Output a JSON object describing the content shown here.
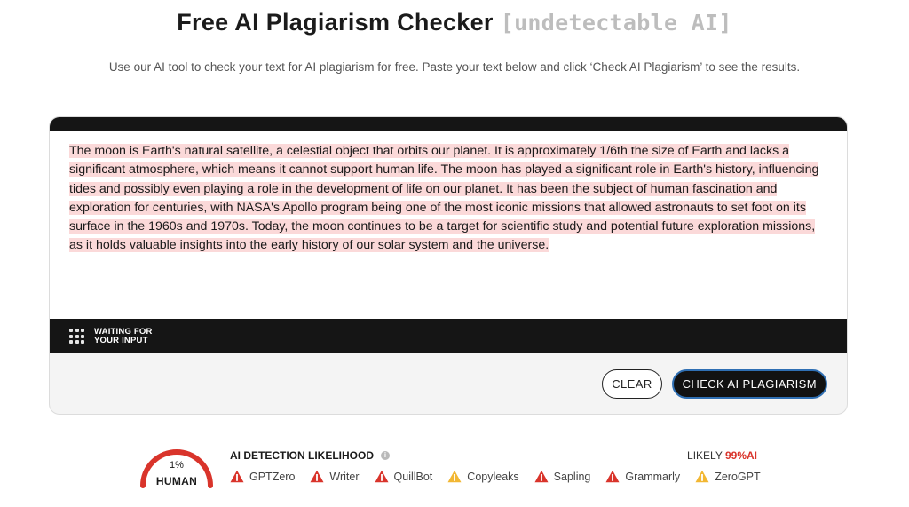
{
  "header": {
    "title": "Free AI Plagiarism Checker",
    "title_tag": "[undetectable AI]",
    "subtitle": "Use our AI tool to check your text for AI plagiarism for free. Paste your text below and click ‘Check AI Plagiarism’ to see the results."
  },
  "editor": {
    "text": "The moon is Earth's natural satellite, a celestial object that orbits our planet. It is approximately 1/6th the size of Earth and lacks a significant atmosphere, which means it cannot support human life. The moon has played a significant role in Earth's history, influencing tides and possibly even playing a role in the development of life on our planet. It has been the subject of human fascination and exploration for centuries, with NASA's Apollo program being one of the most iconic missions that allowed astronauts to set foot on its surface in the 1960s and 1970s. Today, the moon continues to be a target for scientific study and potential future exploration missions, as it holds valuable insights into the early history of our solar system and the universe.",
    "highlight_color": "#fbd9d9",
    "status_line1": "WAITING FOR",
    "status_line2": "YOUR INPUT"
  },
  "actions": {
    "clear_label": "CLEAR",
    "check_label": "CHECK AI PLAGIARISM"
  },
  "result": {
    "gauge_percent": "1%",
    "gauge_value": 0.01,
    "gauge_label": "HUMAN",
    "gauge_color": "#d9342b",
    "detection_title": "AI DETECTION LIKELIHOOD",
    "likely_prefix": "LIKELY",
    "likely_value": "99%AI",
    "detectors": [
      {
        "name": "GPTZero",
        "level": "red",
        "icon": "warning-icon"
      },
      {
        "name": "Writer",
        "level": "red",
        "icon": "warning-icon"
      },
      {
        "name": "QuillBot",
        "level": "red",
        "icon": "warning-icon"
      },
      {
        "name": "Copyleaks",
        "level": "yellow",
        "icon": "warning-icon"
      },
      {
        "name": "Sapling",
        "level": "red",
        "icon": "warning-icon"
      },
      {
        "name": "Grammarly",
        "level": "red",
        "icon": "warning-icon"
      },
      {
        "name": "ZeroGPT",
        "level": "yellow",
        "icon": "warning-icon"
      }
    ],
    "colors": {
      "red": "#d9342b",
      "yellow": "#f2b733"
    }
  }
}
